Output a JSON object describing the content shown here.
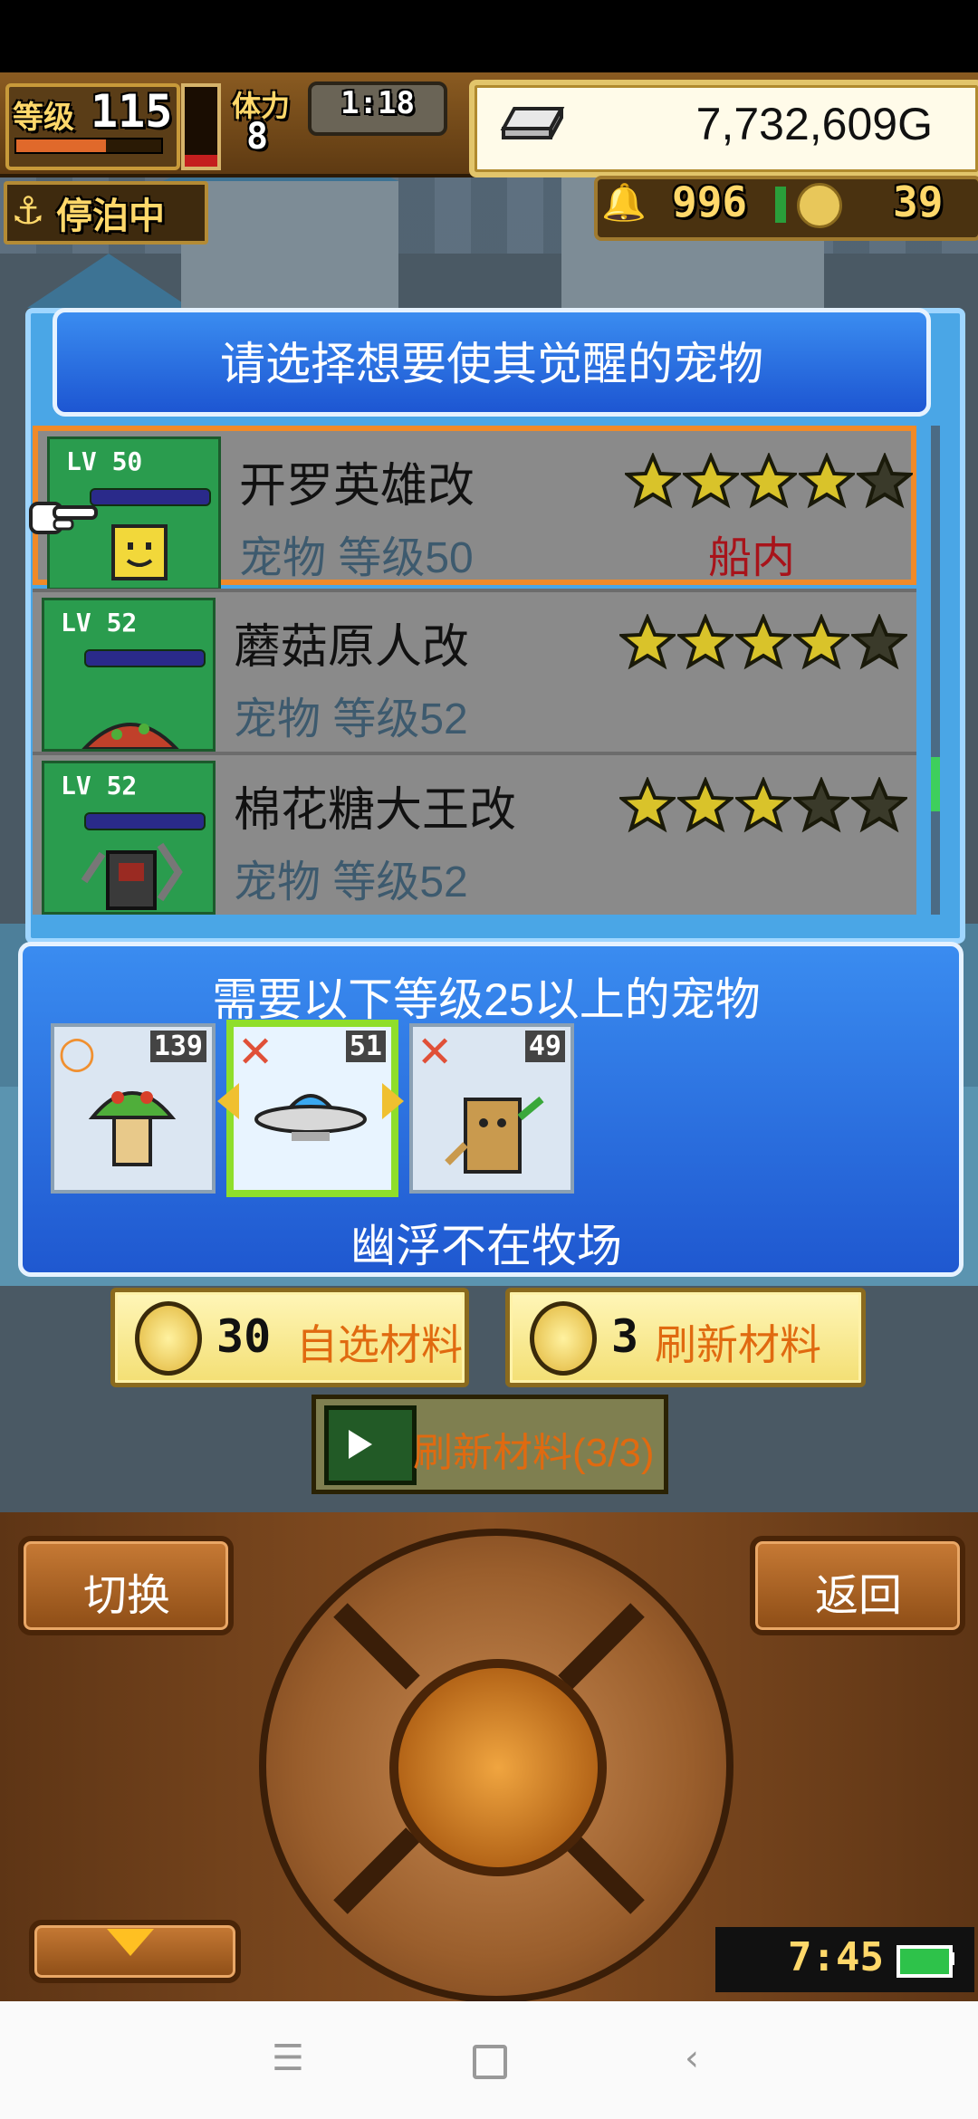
{
  "hud": {
    "level_label": "等级",
    "level_value": "115",
    "xp_fraction": 0.62,
    "stamina_label": "体力",
    "stamina_value": "8",
    "stamina_fraction": 0.15,
    "timer": "1:18",
    "gold": "7,732,609G",
    "docked_status": "停泊中",
    "resource_1": "996",
    "resource_2": "39"
  },
  "select_panel": {
    "title": "请选择想要使其觉醒的宠物",
    "pets": [
      {
        "lv_tag": "LV 50",
        "name": "开罗英雄改",
        "sub": "宠物 等级50",
        "location": "船内",
        "stars": 4,
        "selected": true
      },
      {
        "lv_tag": "LV 52",
        "name": "蘑菇原人改",
        "sub": "宠物 等级52",
        "location": "",
        "stars": 4,
        "selected": false
      },
      {
        "lv_tag": "LV 52",
        "name": "棉花糖大王改",
        "sub": "宠物 等级52",
        "location": "",
        "stars": 3,
        "selected": false
      }
    ]
  },
  "requirement_panel": {
    "title": "需要以下等级25以上的宠物",
    "slots": [
      {
        "level": "139",
        "mark": "○",
        "pet": "mushroom"
      },
      {
        "level": "51",
        "mark": "✕",
        "pet": "ufo"
      },
      {
        "level": "49",
        "mark": "✕",
        "pet": "tree-stump"
      }
    ],
    "status": "幽浮不在牧场"
  },
  "buttons": {
    "choose_cost": "30",
    "choose_label": "自选材料",
    "refresh_cost": "3",
    "refresh_label": "刷新材料",
    "ad_refresh_label": "刷新材料(3/3)",
    "switch_label": "切换",
    "back_label": "返回"
  },
  "status": {
    "clock": "7:45"
  },
  "colors": {
    "selected_border": "#f08a28",
    "location_red": "#a8131a",
    "panel_blue": "#1f58d0",
    "button_text_orange": "#e06a10"
  }
}
